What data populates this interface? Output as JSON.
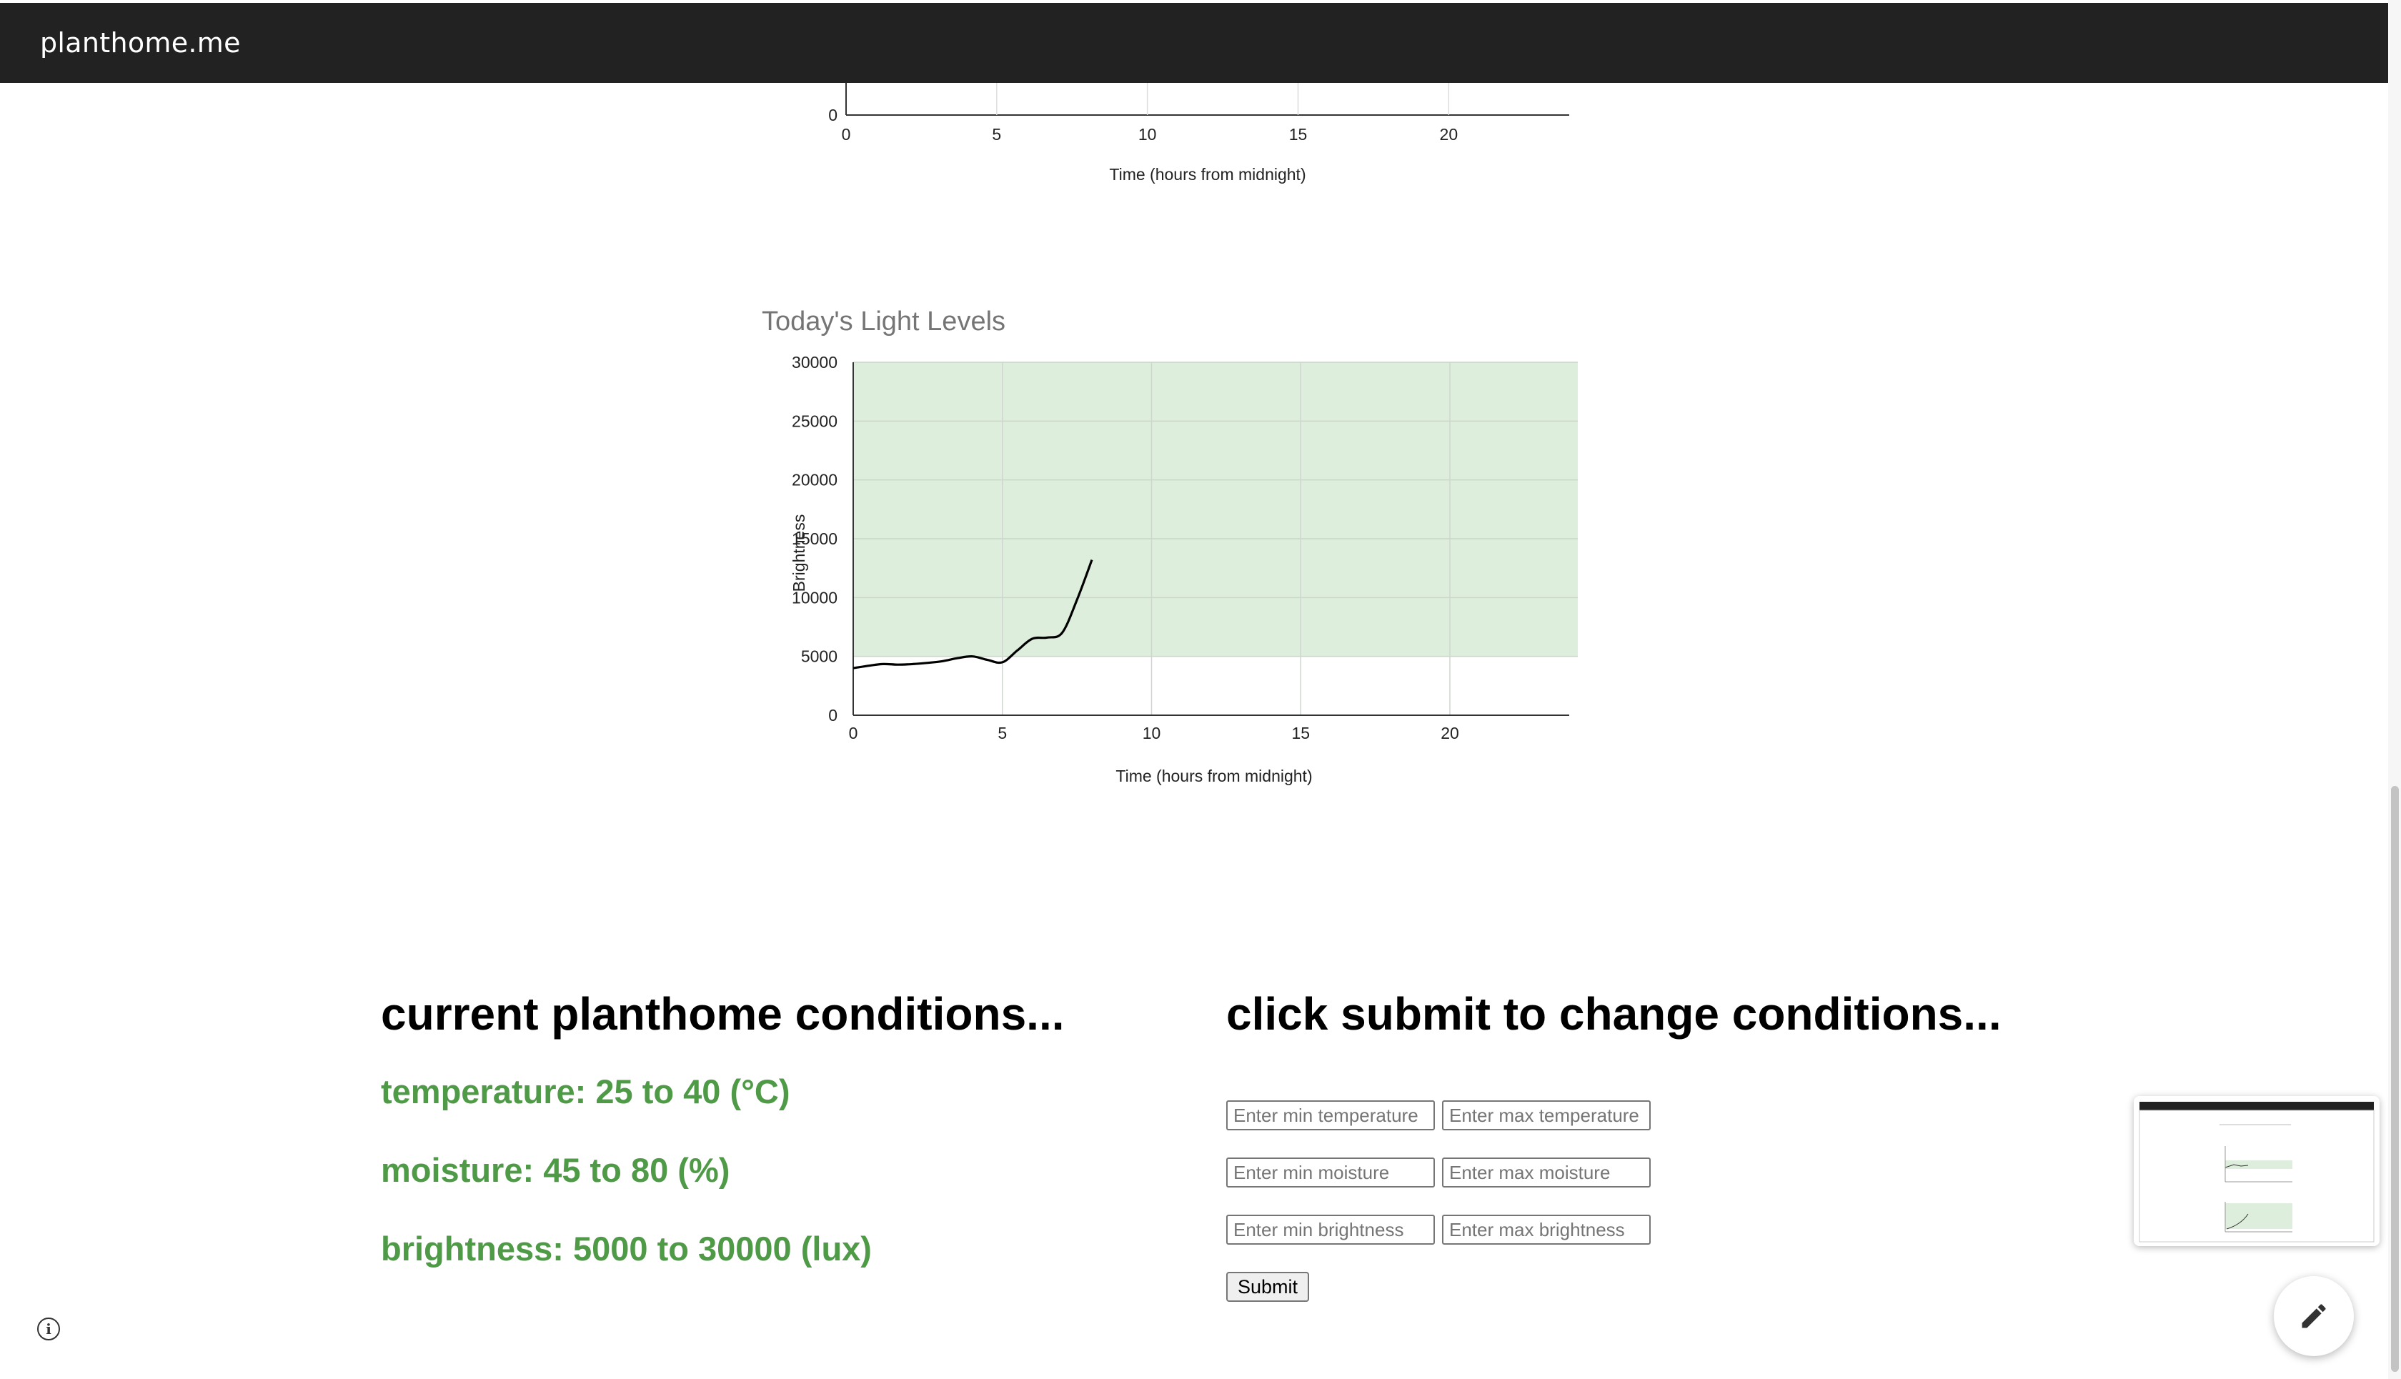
{
  "app": {
    "brand": "planthome.me"
  },
  "chart_data": [
    {
      "type": "line",
      "title": "",
      "xlabel": "Time (hours from midnight)",
      "ylabel": "",
      "x_ticks": [
        0,
        5,
        10,
        15,
        20
      ],
      "y_ticks_visible": [
        0
      ],
      "xlim": [
        0,
        24
      ],
      "note_visible": "partially visible chart; only bottom axis shown"
    },
    {
      "type": "line",
      "title": "Today's Light Levels",
      "xlabel": "Time (hours from midnight)",
      "ylabel": "Brightness",
      "xlim": [
        0,
        24
      ],
      "ylim": [
        0,
        30000
      ],
      "x_ticks": [
        0,
        5,
        10,
        15,
        20
      ],
      "y_ticks": [
        0,
        5000,
        10000,
        15000,
        20000,
        25000,
        30000
      ],
      "x_tick_labels": [
        "0",
        "5",
        "10",
        "15",
        "20"
      ],
      "y_tick_labels": [
        "0",
        "5000",
        "10000",
        "15000",
        "20000",
        "25000",
        "30000"
      ],
      "target_band": [
        5000,
        30000
      ],
      "band_color": "#deeedc",
      "line_color": "#000000",
      "grid": true,
      "series": [
        {
          "x": [
            0,
            0.5,
            1,
            1.5,
            2,
            2.5,
            3,
            3.5,
            4,
            4.5,
            5,
            5.5,
            6,
            6.5,
            7,
            7.5,
            8
          ],
          "values": [
            4000,
            4200,
            4350,
            4300,
            4350,
            4450,
            4600,
            4850,
            5000,
            4700,
            4500,
            5500,
            6500,
            6600,
            7000,
            9800,
            13200
          ]
        }
      ]
    }
  ],
  "conditions": {
    "title": "current planthome conditions...",
    "temperature": "temperature: 25 to 40 (°C)",
    "moisture": "moisture: 45 to 80 (%)",
    "brightness": "brightness: 5000 to 30000 (lux)"
  },
  "form": {
    "title": "click submit to change conditions...",
    "min_temp_placeholder": "Enter min temperature",
    "max_temp_placeholder": "Enter max temperature",
    "min_moist_placeholder": "Enter min moisture",
    "max_moist_placeholder": "Enter max moisture",
    "min_bright_placeholder": "Enter min brightness",
    "max_bright_placeholder": "Enter max brightness",
    "submit_label": "Submit"
  },
  "icons": {
    "info": "info-icon",
    "edit": "pencil-icon",
    "info_glyph": "i"
  },
  "colors": {
    "accent_green": "#4f9a47",
    "topbar": "#222222"
  }
}
